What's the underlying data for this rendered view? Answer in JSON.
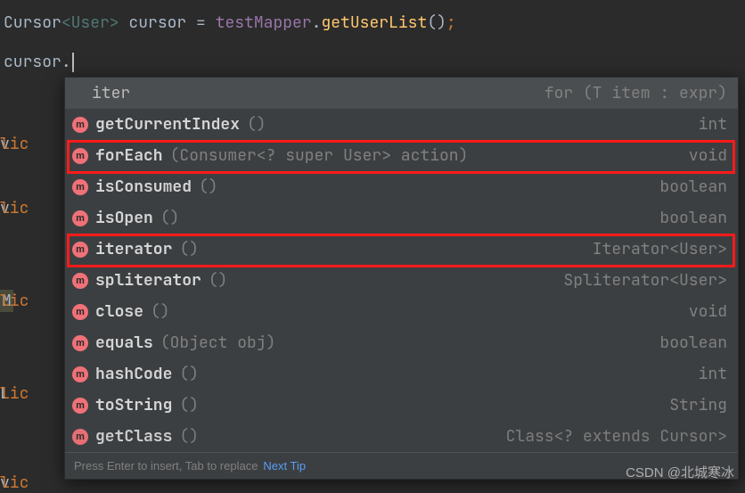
{
  "code": {
    "line1": {
      "type": "Cursor",
      "generic": "<User>",
      "var": " cursor ",
      "assign": "= ",
      "target": "testMapper",
      "dot": ".",
      "method": "getUserList",
      "parens": "()",
      "semi": ";"
    },
    "line2": {
      "obj": "cursor",
      "dot": "."
    }
  },
  "background": {
    "lic1": "lic ",
    "lic2": "lic ",
    "lic3": "lic ",
    "lic4": "lic ",
    "lic5": "lic ",
    "v1": "v",
    "v2": "v",
    "M": "M",
    "L": "L",
    "v3": "v"
  },
  "popup": {
    "items": [
      {
        "kind": "template",
        "name": "iter",
        "ret": "for (T item : expr)"
      },
      {
        "kind": "m",
        "name": "getCurrentIndex",
        "sig": "()",
        "ret": "int"
      },
      {
        "kind": "m",
        "name": "forEach",
        "sig": "(Consumer<? super User> action)",
        "ret": "void"
      },
      {
        "kind": "m",
        "name": "isConsumed",
        "sig": "()",
        "ret": "boolean"
      },
      {
        "kind": "m",
        "name": "isOpen",
        "sig": "()",
        "ret": "boolean"
      },
      {
        "kind": "m",
        "name": "iterator",
        "sig": "()",
        "ret": "Iterator<User>"
      },
      {
        "kind": "m",
        "name": "spliterator",
        "sig": "()",
        "ret": "Spliterator<User>"
      },
      {
        "kind": "m",
        "name": "close",
        "sig": "()",
        "ret": "void"
      },
      {
        "kind": "m",
        "name": "equals",
        "sig": "(Object obj)",
        "ret": "boolean"
      },
      {
        "kind": "m",
        "name": "hashCode",
        "sig": "()",
        "ret": "int"
      },
      {
        "kind": "m",
        "name": "toString",
        "sig": "()",
        "ret": "String"
      },
      {
        "kind": "m",
        "name": "getClass",
        "sig": "()",
        "ret": "Class<? extends Cursor>",
        "cut": true
      }
    ],
    "hint": "Press Enter to insert, Tab to replace",
    "nextTip": "Next Tip"
  },
  "watermark": "CSDN @北城寒冰",
  "iconLabel": "m"
}
